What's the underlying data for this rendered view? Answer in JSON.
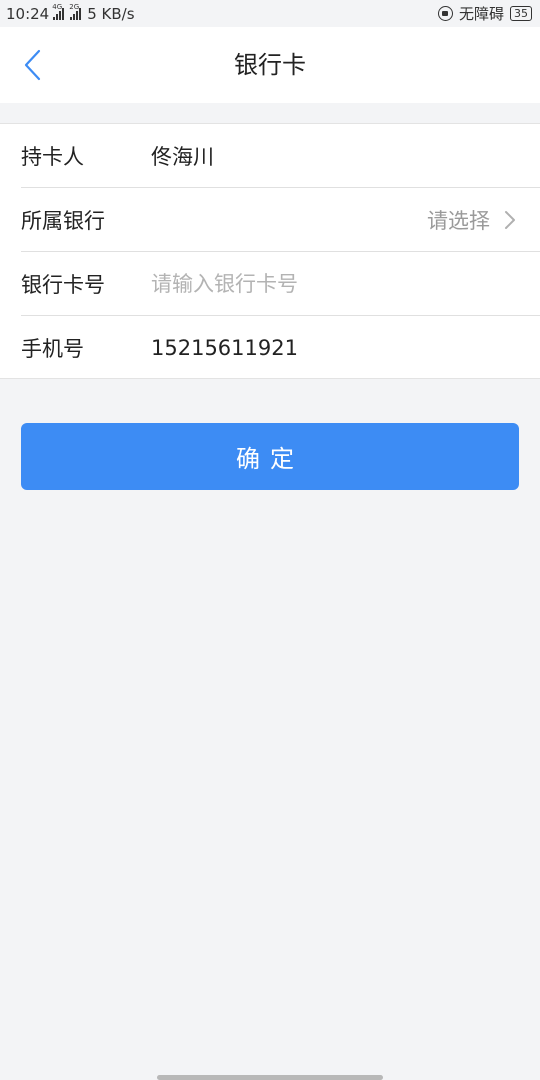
{
  "status_bar": {
    "time": "10:24",
    "network_speed": "5 KB/s",
    "sim1_tag": "4G",
    "sim2_tag": "2G",
    "accessibility": "无障碍",
    "battery": "35"
  },
  "nav": {
    "title": "银行卡"
  },
  "form": {
    "holder": {
      "label": "持卡人",
      "value": "佟海川"
    },
    "bank": {
      "label": "所属银行",
      "placeholder": "请选择"
    },
    "card_number": {
      "label": "银行卡号",
      "placeholder": "请输入银行卡号",
      "value": ""
    },
    "phone": {
      "label": "手机号",
      "value": "15215611921"
    }
  },
  "confirm_button": {
    "label": "确定"
  },
  "colors": {
    "accent": "#3d8cf4",
    "page_background": "#f3f4f6"
  }
}
